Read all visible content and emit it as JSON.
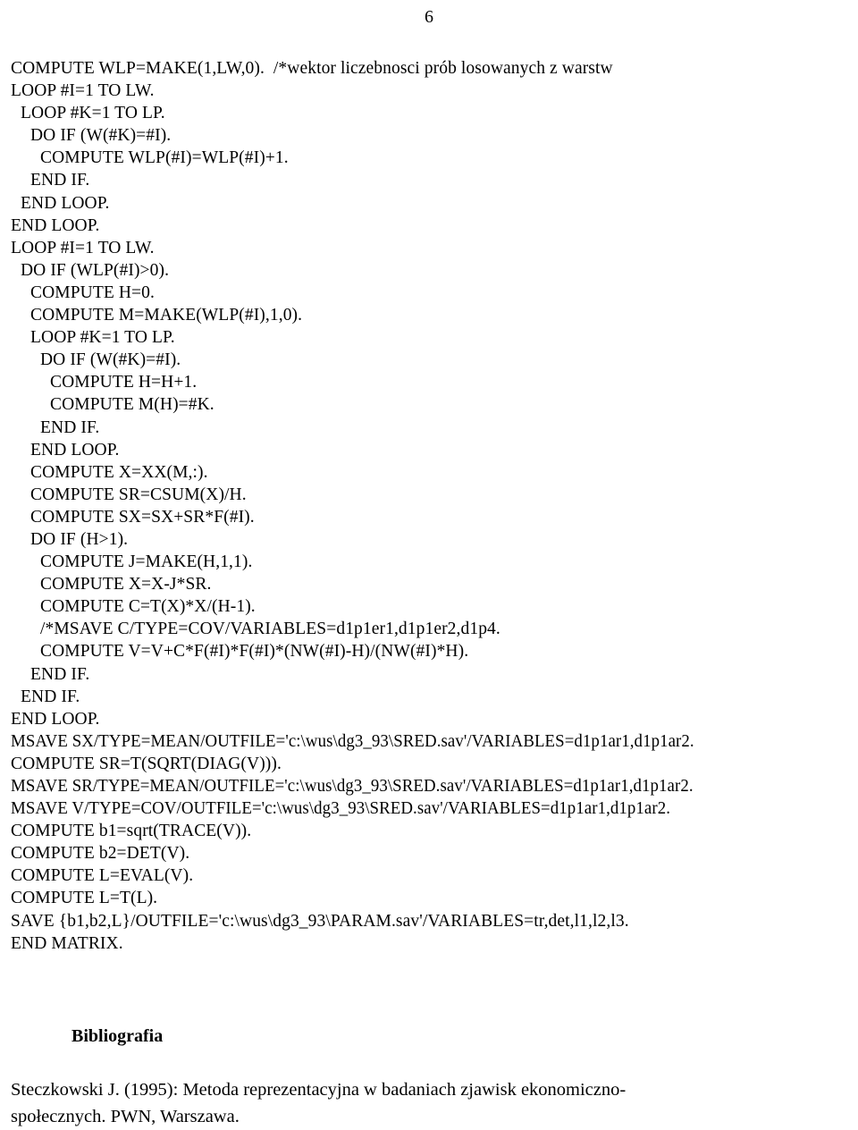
{
  "page": {
    "number": "6"
  },
  "code": {
    "lines": [
      {
        "indent": 0,
        "text": "COMPUTE WLP=MAKE(1,LW,0).  /*wektor liczebnosci prób losowanych z warstw"
      },
      {
        "indent": 0,
        "text": "LOOP #I=1 TO LW."
      },
      {
        "indent": 1,
        "text": "LOOP #K=1 TO LP."
      },
      {
        "indent": 2,
        "text": "DO IF (W(#K)=#I)."
      },
      {
        "indent": 3,
        "text": "COMPUTE WLP(#I)=WLP(#I)+1."
      },
      {
        "indent": 2,
        "text": "END IF."
      },
      {
        "indent": 1,
        "text": "END LOOP."
      },
      {
        "indent": 0,
        "text": "END LOOP."
      },
      {
        "indent": 0,
        "text": "LOOP #I=1 TO LW."
      },
      {
        "indent": 1,
        "text": "DO IF (WLP(#I)>0)."
      },
      {
        "indent": 2,
        "text": "COMPUTE H=0."
      },
      {
        "indent": 2,
        "text": "COMPUTE M=MAKE(WLP(#I),1,0)."
      },
      {
        "indent": 2,
        "text": "LOOP #K=1 TO LP."
      },
      {
        "indent": 3,
        "text": "DO IF (W(#K)=#I)."
      },
      {
        "indent": 4,
        "text": "COMPUTE H=H+1."
      },
      {
        "indent": 4,
        "text": "COMPUTE M(H)=#K."
      },
      {
        "indent": 3,
        "text": "END IF."
      },
      {
        "indent": 2,
        "text": "END LOOP."
      },
      {
        "indent": 2,
        "text": "COMPUTE X=XX(M,:)."
      },
      {
        "indent": 2,
        "text": "COMPUTE SR=CSUM(X)/H."
      },
      {
        "indent": 2,
        "text": "COMPUTE SX=SX+SR*F(#I)."
      },
      {
        "indent": 2,
        "text": "DO IF (H>1)."
      },
      {
        "indent": 3,
        "text": "COMPUTE J=MAKE(H,1,1)."
      },
      {
        "indent": 3,
        "text": "COMPUTE X=X-J*SR."
      },
      {
        "indent": 3,
        "text": "COMPUTE C=T(X)*X/(H-1)."
      },
      {
        "indent": 3,
        "text": "/*MSAVE C/TYPE=COV/VARIABLES=d1p1er1,d1p1er2,d1p4."
      },
      {
        "indent": 3,
        "text": "COMPUTE V=V+C*F(#I)*F(#I)*(NW(#I)-H)/(NW(#I)*H)."
      },
      {
        "indent": 2,
        "text": "END IF."
      },
      {
        "indent": 1,
        "text": "END IF."
      },
      {
        "indent": 0,
        "text": "END LOOP."
      },
      {
        "indent": 0,
        "text": "MSAVE SX/TYPE=MEAN/OUTFILE='c:\\wus\\dg3_93\\SRED.sav'/VARIABLES=d1p1ar1,d1p1ar2.",
        "condensed": true
      },
      {
        "indent": 0,
        "text": "COMPUTE SR=T(SQRT(DIAG(V)))."
      },
      {
        "indent": 0,
        "text": "MSAVE SR/TYPE=MEAN/OUTFILE='c:\\wus\\dg3_93\\SRED.sav'/VARIABLES=d1p1ar1,d1p1ar2.",
        "condensed": true
      },
      {
        "indent": 0,
        "text": "MSAVE V/TYPE=COV/OUTFILE='c:\\wus\\dg3_93\\SRED.sav'/VARIABLES=d1p1ar1,d1p1ar2.",
        "condensed": true
      },
      {
        "indent": 0,
        "text": "COMPUTE b1=sqrt(TRACE(V))."
      },
      {
        "indent": 0,
        "text": "COMPUTE b2=DET(V)."
      },
      {
        "indent": 0,
        "text": "COMPUTE L=EVAL(V)."
      },
      {
        "indent": 0,
        "text": "COMPUTE L=T(L)."
      },
      {
        "indent": 0,
        "text": "SAVE {b1,b2,L}/OUTFILE='c:\\wus\\dg3_93\\PARAM.sav'/VARIABLES=tr,det,l1,l2,l3."
      },
      {
        "indent": 0,
        "text": "END MATRIX."
      }
    ]
  },
  "bibliography": {
    "heading": "Bibliografia",
    "entries": [
      {
        "line1": "Steczkowski J. (1995): Metoda reprezentacyjna w badaniach zjawisk ekonomiczno-",
        "line2": "społecznych. PWN, Warszawa."
      }
    ]
  }
}
